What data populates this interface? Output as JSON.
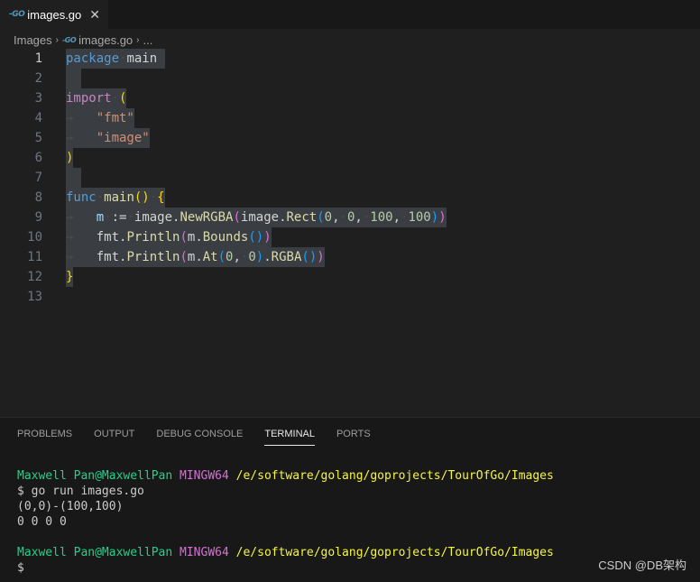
{
  "tab": {
    "icon": "go-file-icon",
    "icon_text": "-GO",
    "title": "images.go",
    "close": "✕"
  },
  "breadcrumb": {
    "folder": "Images",
    "sep": "›",
    "icon_text": "-GO",
    "file": "images.go",
    "more": "..."
  },
  "editor": {
    "active_line": 1,
    "lines": [
      {
        "n": "1",
        "tokens": [
          [
            "kw",
            "package"
          ],
          [
            "ws",
            "·"
          ],
          [
            "txt",
            "main"
          ],
          [
            "ws",
            " "
          ]
        ]
      },
      {
        "n": "2",
        "tokens": [
          [
            "ws",
            "  "
          ]
        ]
      },
      {
        "n": "3",
        "tokens": [
          [
            "ctl",
            "import"
          ],
          [
            "ws",
            "·"
          ],
          [
            "b1",
            "("
          ]
        ]
      },
      {
        "n": "4",
        "tokens": [
          [
            "ws",
            "→   "
          ],
          [
            "str",
            "\"fmt\""
          ]
        ]
      },
      {
        "n": "5",
        "tokens": [
          [
            "ws",
            "→   "
          ],
          [
            "str",
            "\"image\""
          ]
        ]
      },
      {
        "n": "6",
        "tokens": [
          [
            "b1",
            ")"
          ]
        ]
      },
      {
        "n": "7",
        "tokens": [
          [
            "ws",
            "  "
          ]
        ]
      },
      {
        "n": "8",
        "tokens": [
          [
            "kw",
            "func"
          ],
          [
            "ws",
            "·"
          ],
          [
            "fn",
            "main"
          ],
          [
            "b1",
            "()"
          ],
          [
            "ws",
            "·"
          ],
          [
            "b1",
            "{"
          ]
        ]
      },
      {
        "n": "9",
        "tokens": [
          [
            "ws",
            "→   "
          ],
          [
            "var",
            "m"
          ],
          [
            "ws",
            "·"
          ],
          [
            "txt",
            ":="
          ],
          [
            "ws",
            "·"
          ],
          [
            "txt",
            "image."
          ],
          [
            "fn",
            "NewRGBA"
          ],
          [
            "b2",
            "("
          ],
          [
            "txt",
            "image."
          ],
          [
            "fn",
            "Rect"
          ],
          [
            "b3",
            "("
          ],
          [
            "num",
            "0"
          ],
          [
            "txt",
            ","
          ],
          [
            "ws",
            "·"
          ],
          [
            "num",
            "0"
          ],
          [
            "txt",
            ","
          ],
          [
            "ws",
            "·"
          ],
          [
            "num",
            "100"
          ],
          [
            "txt",
            ","
          ],
          [
            "ws",
            "·"
          ],
          [
            "num",
            "100"
          ],
          [
            "b3",
            ")"
          ],
          [
            "b2",
            ")"
          ]
        ]
      },
      {
        "n": "10",
        "tokens": [
          [
            "ws",
            "→   "
          ],
          [
            "txt",
            "fmt."
          ],
          [
            "fn",
            "Println"
          ],
          [
            "b2",
            "("
          ],
          [
            "txt",
            "m."
          ],
          [
            "fn",
            "Bounds"
          ],
          [
            "b3",
            "()"
          ],
          [
            "b2",
            ")"
          ]
        ]
      },
      {
        "n": "11",
        "tokens": [
          [
            "ws",
            "→   "
          ],
          [
            "txt",
            "fmt."
          ],
          [
            "fn",
            "Println"
          ],
          [
            "b2",
            "("
          ],
          [
            "txt",
            "m."
          ],
          [
            "fn",
            "At"
          ],
          [
            "b3",
            "("
          ],
          [
            "num",
            "0"
          ],
          [
            "txt",
            ","
          ],
          [
            "ws",
            "·"
          ],
          [
            "num",
            "0"
          ],
          [
            "b3",
            ")"
          ],
          [
            "txt",
            "."
          ],
          [
            "fn",
            "RGBA"
          ],
          [
            "b3",
            "()"
          ],
          [
            "b2",
            ")"
          ]
        ]
      },
      {
        "n": "12",
        "tokens": [
          [
            "b1",
            "}"
          ]
        ]
      },
      {
        "n": "13",
        "tokens": []
      }
    ]
  },
  "panel": {
    "tabs": [
      "PROBLEMS",
      "OUTPUT",
      "DEBUG CONSOLE",
      "TERMINAL",
      "PORTS"
    ],
    "active_tab": "TERMINAL"
  },
  "terminal": {
    "lines": [
      [
        [
          "t-green",
          "Maxwell Pan@MaxwellPan"
        ],
        [
          "",
          "·"
        ],
        [
          "t-magenta",
          "MINGW64"
        ],
        [
          "",
          "·"
        ],
        [
          "t-yellow",
          "/e/software/golang/goprojects/TourOfGo/Images"
        ]
      ],
      [
        [
          "",
          "$ go run images.go"
        ]
      ],
      [
        [
          "",
          "(0,0)-(100,100)"
        ]
      ],
      [
        [
          "",
          "0 0 0 0"
        ]
      ],
      [
        [
          "",
          ""
        ]
      ],
      [
        [
          "t-green",
          "Maxwell Pan@MaxwellPan"
        ],
        [
          "",
          "·"
        ],
        [
          "t-magenta",
          "MINGW64"
        ],
        [
          "",
          "·"
        ],
        [
          "t-yellow",
          "/e/software/golang/goprojects/TourOfGo/Images"
        ]
      ],
      [
        [
          "",
          "$"
        ]
      ]
    ]
  },
  "watermark": "CSDN @DB架构"
}
